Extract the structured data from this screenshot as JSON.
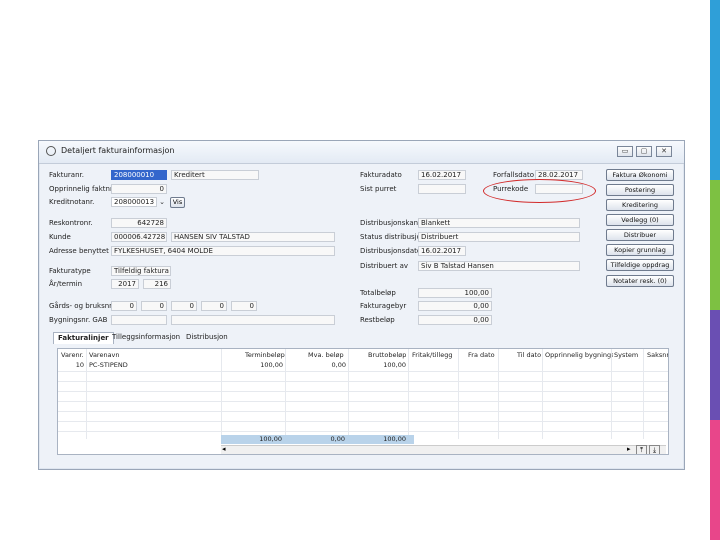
{
  "window": {
    "title": "Detaljert fakturainformasjon",
    "controls": [
      "▭",
      "▢",
      "✕"
    ]
  },
  "left": {
    "fakturanr_label": "Fakturanr.",
    "fakturanr_value": "208000010",
    "fakturanr_status": "Kreditert",
    "opprinnelig_label": "Opprinnelig faktnr.",
    "opprinnelig_value": "0",
    "kreditnota_label": "Kreditnotanr.",
    "kreditnota_value": "208000013",
    "vis_label": "Vis",
    "reskontro_label": "Reskontronr.",
    "reskontro_value": "642728",
    "kunde_label": "Kunde",
    "kunde_nr": "000006.42728",
    "kunde_navn": "HANSEN SIV TALSTAD",
    "adresse_label": "Adresse benyttet",
    "adresse_value": "FYLKESHUSET, 6404 MOLDE",
    "fakturatype_label": "Fakturatype",
    "fakturatype_value": "Tilfeldig faktura",
    "ar_label": "År/termin",
    "ar_value": "2017",
    "termin_value": "216",
    "gards_label": "Gårds- og bruksnr.",
    "gards_values": [
      "0",
      "0",
      "0",
      "0",
      "0"
    ],
    "bygning_label": "Bygningsnr. GAB"
  },
  "middle": {
    "fakturadato_label": "Fakturadato",
    "fakturadato_value": "16.02.2017",
    "sist_purret_label": "Sist purret",
    "distkanal_label": "Distribusjonskanal",
    "distkanal_value": "Blankett",
    "status_label": "Status distribusjon",
    "status_value": "Distribuert",
    "distdato_label": "Distribusjonsdato",
    "distdato_value": "16.02.2017",
    "distav_label": "Distribuert av",
    "distav_value": "Siv B Talstad Hansen",
    "total_label": "Totalbeløp",
    "total_value": "100,00",
    "gebyr_label": "Fakturagebyr",
    "gebyr_value": "0,00",
    "rest_label": "Restbeløp",
    "rest_value": "0,00"
  },
  "right": {
    "forfall_label": "Forfallsdato",
    "forfall_value": "28.02.2017",
    "purrekode_label": "Purrekode",
    "purrekode_value": ""
  },
  "buttons": [
    "Faktura Økonomi",
    "Postering",
    "Kreditering",
    "Vedlegg (0)",
    "Distribuer",
    "Kopier grunnlag",
    "Tilfeldige oppdrag",
    "Notater resk. (0)"
  ],
  "tabs": [
    "Fakturalinjer",
    "Tilleggsinformasjon",
    "Distribusjon"
  ],
  "grid": {
    "headers": [
      "Varenr.",
      "Varenavn",
      "Terminbeløp",
      "Mva. beløp",
      "Bruttobeløp",
      "Fritak/tillegg",
      "Fra dato",
      "Til dato",
      "Opprinnelig bygningsn",
      "System",
      "Saksnr"
    ],
    "row": {
      "varenr": "10",
      "varenavn": "PC-STIPEND",
      "terminbelop": "100,00",
      "mva": "0,00",
      "brutto": "100,00"
    },
    "totals": {
      "terminbelop": "100,00",
      "mva": "0,00",
      "brutto": "100,00"
    }
  },
  "colors": {
    "highlight": "#3366cc",
    "annotation": "#d22a2a",
    "deco_top": "#2f9fd8",
    "deco_mid": "#7dc142",
    "deco_bottom": "#e8468a"
  }
}
